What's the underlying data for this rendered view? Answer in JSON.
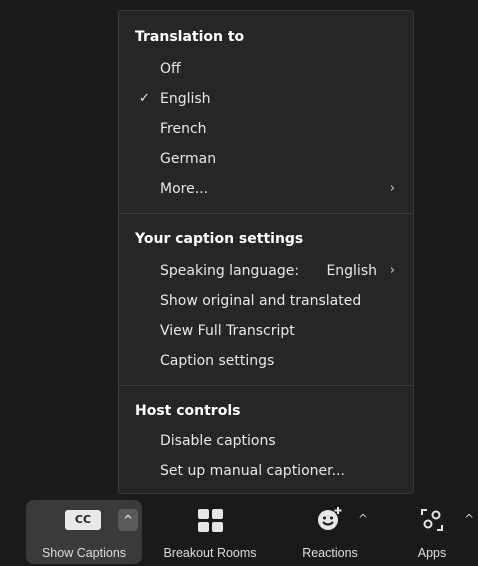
{
  "menu": {
    "translation": {
      "heading": "Translation to",
      "items": [
        {
          "label": "Off",
          "checked": false
        },
        {
          "label": "English",
          "checked": true
        },
        {
          "label": "French",
          "checked": false
        },
        {
          "label": "German",
          "checked": false
        },
        {
          "label": "More...",
          "submenu": true
        }
      ]
    },
    "caption_settings": {
      "heading": "Your caption settings",
      "speaking_language_label": "Speaking language:",
      "speaking_language_value": "English",
      "show_original": "Show original and translated",
      "view_transcript": "View Full Transcript",
      "caption_settings": "Caption settings"
    },
    "host_controls": {
      "heading": "Host controls",
      "disable_captions": "Disable captions",
      "manual_captioner": "Set up manual captioner..."
    }
  },
  "toolbar": {
    "show_captions": "Show Captions",
    "cc_text": "CC",
    "breakout_rooms": "Breakout Rooms",
    "reactions": "Reactions",
    "apps": "Apps"
  },
  "icons": {
    "check": "check-icon",
    "chevron": "chevron-right-icon",
    "caret": "caret-up-icon"
  },
  "colors": {
    "menu_bg": "#262626",
    "toolbar_bg": "#1a1a1a",
    "active_button_bg": "#3a3a3a"
  }
}
